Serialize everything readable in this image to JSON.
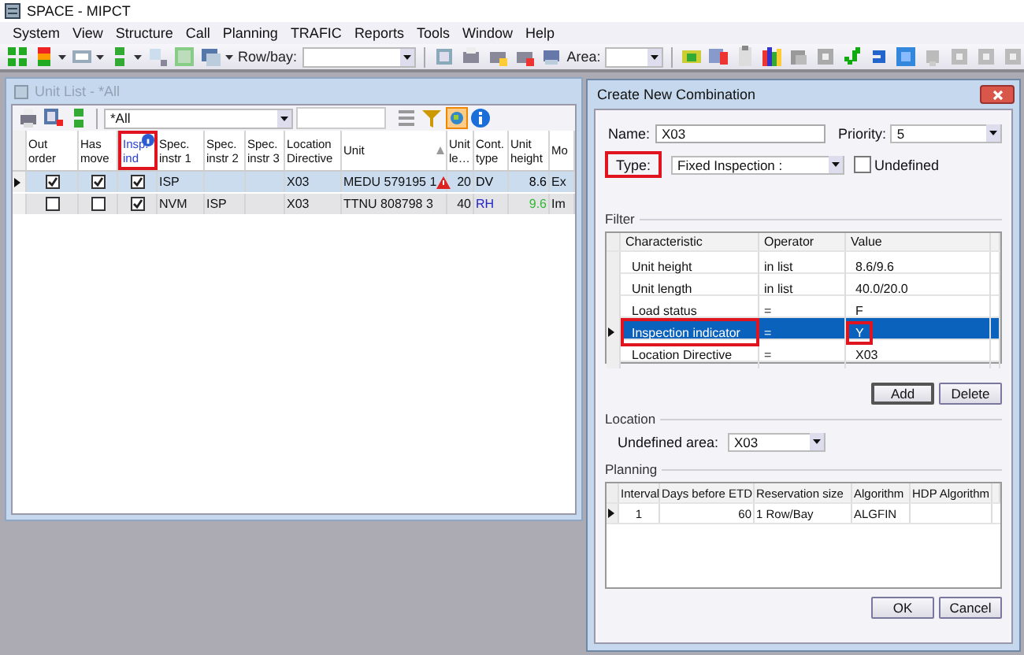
{
  "window": {
    "title": "SPACE - MIPCT"
  },
  "menu": [
    "System",
    "View",
    "Structure",
    "Call",
    "Planning",
    "TRAFIC",
    "Reports",
    "Tools",
    "Window",
    "Help"
  ],
  "toolbar": {
    "row_bay_label": "Row/bay:",
    "area_label": "Area:"
  },
  "unit_list": {
    "title": "Unit List - *All",
    "filter": "*All",
    "columns": [
      {
        "label": "Out order",
        "highlighted": false,
        "info": false,
        "sorted": false
      },
      {
        "label": "Has move",
        "highlighted": false,
        "info": false,
        "sorted": false
      },
      {
        "label": "Insp. ind",
        "highlighted": true,
        "info": true,
        "sorted": false
      },
      {
        "label": "Spec. instr 1",
        "highlighted": false,
        "info": false,
        "sorted": false
      },
      {
        "label": "Spec. instr 2",
        "highlighted": false,
        "info": false,
        "sorted": false
      },
      {
        "label": "Spec. instr 3",
        "highlighted": false,
        "info": false,
        "sorted": false
      },
      {
        "label": "Location Directive",
        "highlighted": false,
        "info": false,
        "sorted": false
      },
      {
        "label": "Unit",
        "highlighted": false,
        "info": false,
        "sorted": true
      },
      {
        "label": "Unit le…",
        "highlighted": false,
        "info": false,
        "sorted": false
      },
      {
        "label": "Cont. type",
        "highlighted": false,
        "info": false,
        "sorted": false
      },
      {
        "label": "Unit height",
        "highlighted": false,
        "info": false,
        "sorted": false
      },
      {
        "label": "Mo",
        "highlighted": false,
        "info": false,
        "sorted": false
      }
    ],
    "rows": [
      {
        "selected": true,
        "cells": [
          {
            "kind": "check",
            "checked": true
          },
          {
            "kind": "check",
            "checked": true
          },
          {
            "kind": "check",
            "checked": true
          },
          {
            "kind": "text",
            "text": "ISP"
          },
          {
            "kind": "blank"
          },
          {
            "kind": "blank"
          },
          {
            "kind": "text",
            "text": "X03"
          },
          {
            "kind": "unit",
            "text": "MEDU 579195 1",
            "warning": true
          },
          {
            "kind": "text",
            "text": "20"
          },
          {
            "kind": "text",
            "text": "DV",
            "color": "#000000"
          },
          {
            "kind": "text",
            "text": "8.6",
            "color": "#000000"
          },
          {
            "kind": "text",
            "text": "Ex"
          }
        ]
      },
      {
        "selected": false,
        "cells": [
          {
            "kind": "check",
            "checked": false
          },
          {
            "kind": "check",
            "checked": false
          },
          {
            "kind": "check",
            "checked": true
          },
          {
            "kind": "text",
            "text": "NVM"
          },
          {
            "kind": "text",
            "text": "ISP"
          },
          {
            "kind": "blank"
          },
          {
            "kind": "text",
            "text": "X03"
          },
          {
            "kind": "unit",
            "text": "TTNU 808798 3",
            "warning": false
          },
          {
            "kind": "text",
            "text": "40"
          },
          {
            "kind": "text",
            "text": "RH",
            "color": "#2323c8"
          },
          {
            "kind": "text",
            "text": "9.6",
            "color": "#33b833"
          },
          {
            "kind": "text",
            "text": "Im"
          }
        ]
      }
    ]
  },
  "dialog": {
    "title": "Create New Combination",
    "name": {
      "label": "Name:",
      "value": "X03"
    },
    "priority": {
      "label": "Priority:",
      "value": "5"
    },
    "type": {
      "label": "Type:",
      "value": "Fixed Inspection :",
      "highlighted": true
    },
    "undefined": {
      "label": "Undefined",
      "checked": false
    },
    "filter": {
      "title": "Filter",
      "columns": [
        "Characteristic",
        "Operator",
        "Value"
      ],
      "rows": [
        {
          "characteristic": "Unit height",
          "operator": "in list",
          "value": "8.6/9.6",
          "selected": false,
          "highlighted": false
        },
        {
          "characteristic": "Unit length",
          "operator": "in list",
          "value": "40.0/20.0",
          "selected": false,
          "highlighted": false
        },
        {
          "characteristic": "Load status",
          "operator": "=",
          "value": "F",
          "selected": false,
          "highlighted": false
        },
        {
          "characteristic": "Inspection indicator",
          "operator": "=",
          "value": "Y",
          "selected": true,
          "highlighted": true
        },
        {
          "characteristic": "Location Directive",
          "operator": "=",
          "value": "X03",
          "selected": false,
          "highlighted": false
        }
      ]
    },
    "add_button": "Add",
    "delete_button": "Delete",
    "location": {
      "title": "Location",
      "label": "Undefined area:",
      "value": "X03"
    },
    "planning": {
      "title": "Planning",
      "columns": [
        "Interval",
        "Days before ETD",
        "Reservation size",
        "Algorithm",
        "HDP Algorithm"
      ],
      "rows": [
        {
          "interval": "1",
          "days_before_etd": "60",
          "reservation_size": "1 Row/Bay",
          "algorithm": "ALGFIN",
          "selected": true
        }
      ]
    },
    "ok_button": "OK",
    "cancel_button": "Cancel"
  }
}
